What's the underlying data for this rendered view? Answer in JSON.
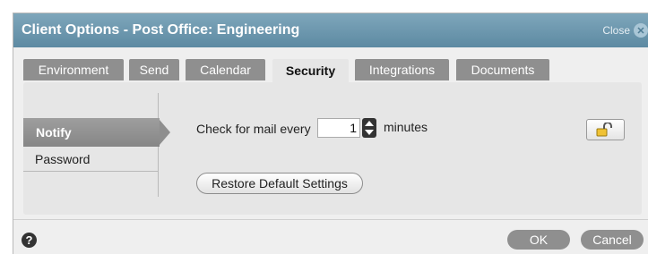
{
  "dialog": {
    "title": "Client Options - Post Office: Engineering",
    "close_label": "Close",
    "close_icon": "close-icon"
  },
  "tabs": [
    {
      "label": "Environment",
      "active": false
    },
    {
      "label": "Send",
      "active": false
    },
    {
      "label": "Calendar",
      "active": false
    },
    {
      "label": "Security",
      "active": true
    },
    {
      "label": "Integrations",
      "active": false
    },
    {
      "label": "Documents",
      "active": false
    }
  ],
  "nav": {
    "items": [
      {
        "label": "Notify",
        "selected": true
      },
      {
        "label": "Password",
        "selected": false
      }
    ]
  },
  "notify": {
    "check_label": "Check for mail every",
    "interval_value": "1",
    "unit_label": "minutes",
    "lock_icon": "unlocked-padlock-icon",
    "restore_label": "Restore Default Settings"
  },
  "footer": {
    "help_glyph": "?",
    "ok_label": "OK",
    "cancel_label": "Cancel"
  },
  "colors": {
    "titlebar": "#6a95ab",
    "tab_inactive": "#8f8f8f",
    "tab_active": "#e6e6e6",
    "panel": "#e6e6e6",
    "button_dark": "#8f8f8f"
  }
}
